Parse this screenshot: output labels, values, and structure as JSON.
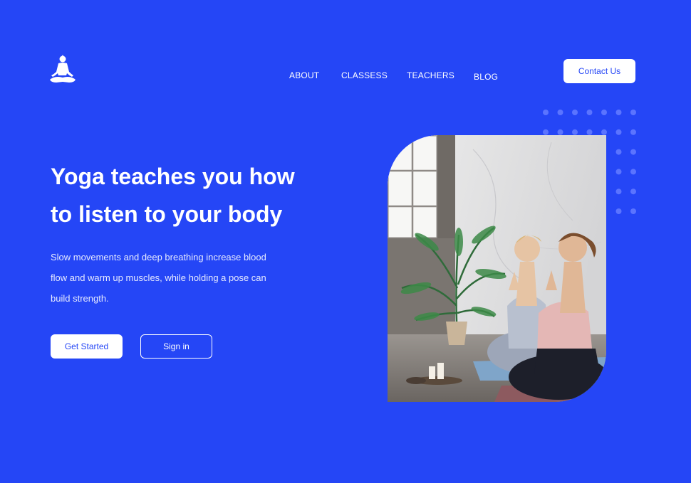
{
  "nav": {
    "logo_icon": "meditation-figure-icon",
    "links": [
      "ABOUT",
      "CLASSESS",
      "TEACHERS",
      "BLOG"
    ],
    "contact_label": "Contact Us"
  },
  "hero": {
    "headline_line1": "Yoga teaches you how",
    "headline_line2": "to listen to your body",
    "description_line1": "Slow movements and deep breathing increase blood",
    "description_line2": "flow and warm up muscles, while holding a pose can",
    "description_line3": "build strength.",
    "primary_button": "Get Started",
    "secondary_button": "Sign in",
    "image_subject": "two women meditating in prayer pose"
  },
  "colors": {
    "background": "#2546f6",
    "button_text": "#2546f6",
    "white": "#ffffff"
  }
}
